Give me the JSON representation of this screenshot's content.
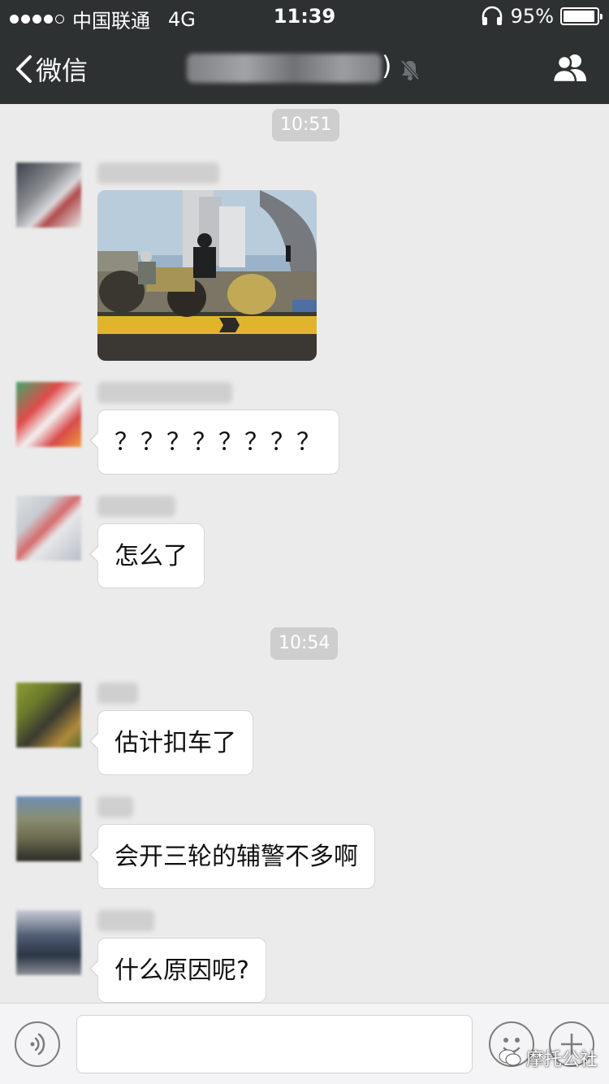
{
  "status_bar": {
    "carrier": "中国联通",
    "network": "4G",
    "time": "11:39",
    "battery": "95%",
    "battery_level": 0.95
  },
  "nav": {
    "back_label": "微信",
    "title_suffix": ")"
  },
  "timestamps": [
    "10:51",
    "10:54"
  ],
  "messages": [
    {
      "type": "image",
      "description_icon": "photo"
    },
    {
      "type": "text",
      "text": "？？？？？？？？"
    },
    {
      "type": "text",
      "text": "怎么了"
    },
    {
      "type": "text",
      "text": "估计扣车了"
    },
    {
      "type": "text",
      "text": "会开三轮的辅警不多啊"
    },
    {
      "type": "text",
      "text": "什么原因呢?"
    }
  ],
  "watermark": {
    "text": "摩托公社"
  },
  "colors": {
    "topbar": "#2e3132",
    "background": "#ebebeb",
    "bubble": "#ffffff",
    "timestamp_bg": "#cecece"
  }
}
